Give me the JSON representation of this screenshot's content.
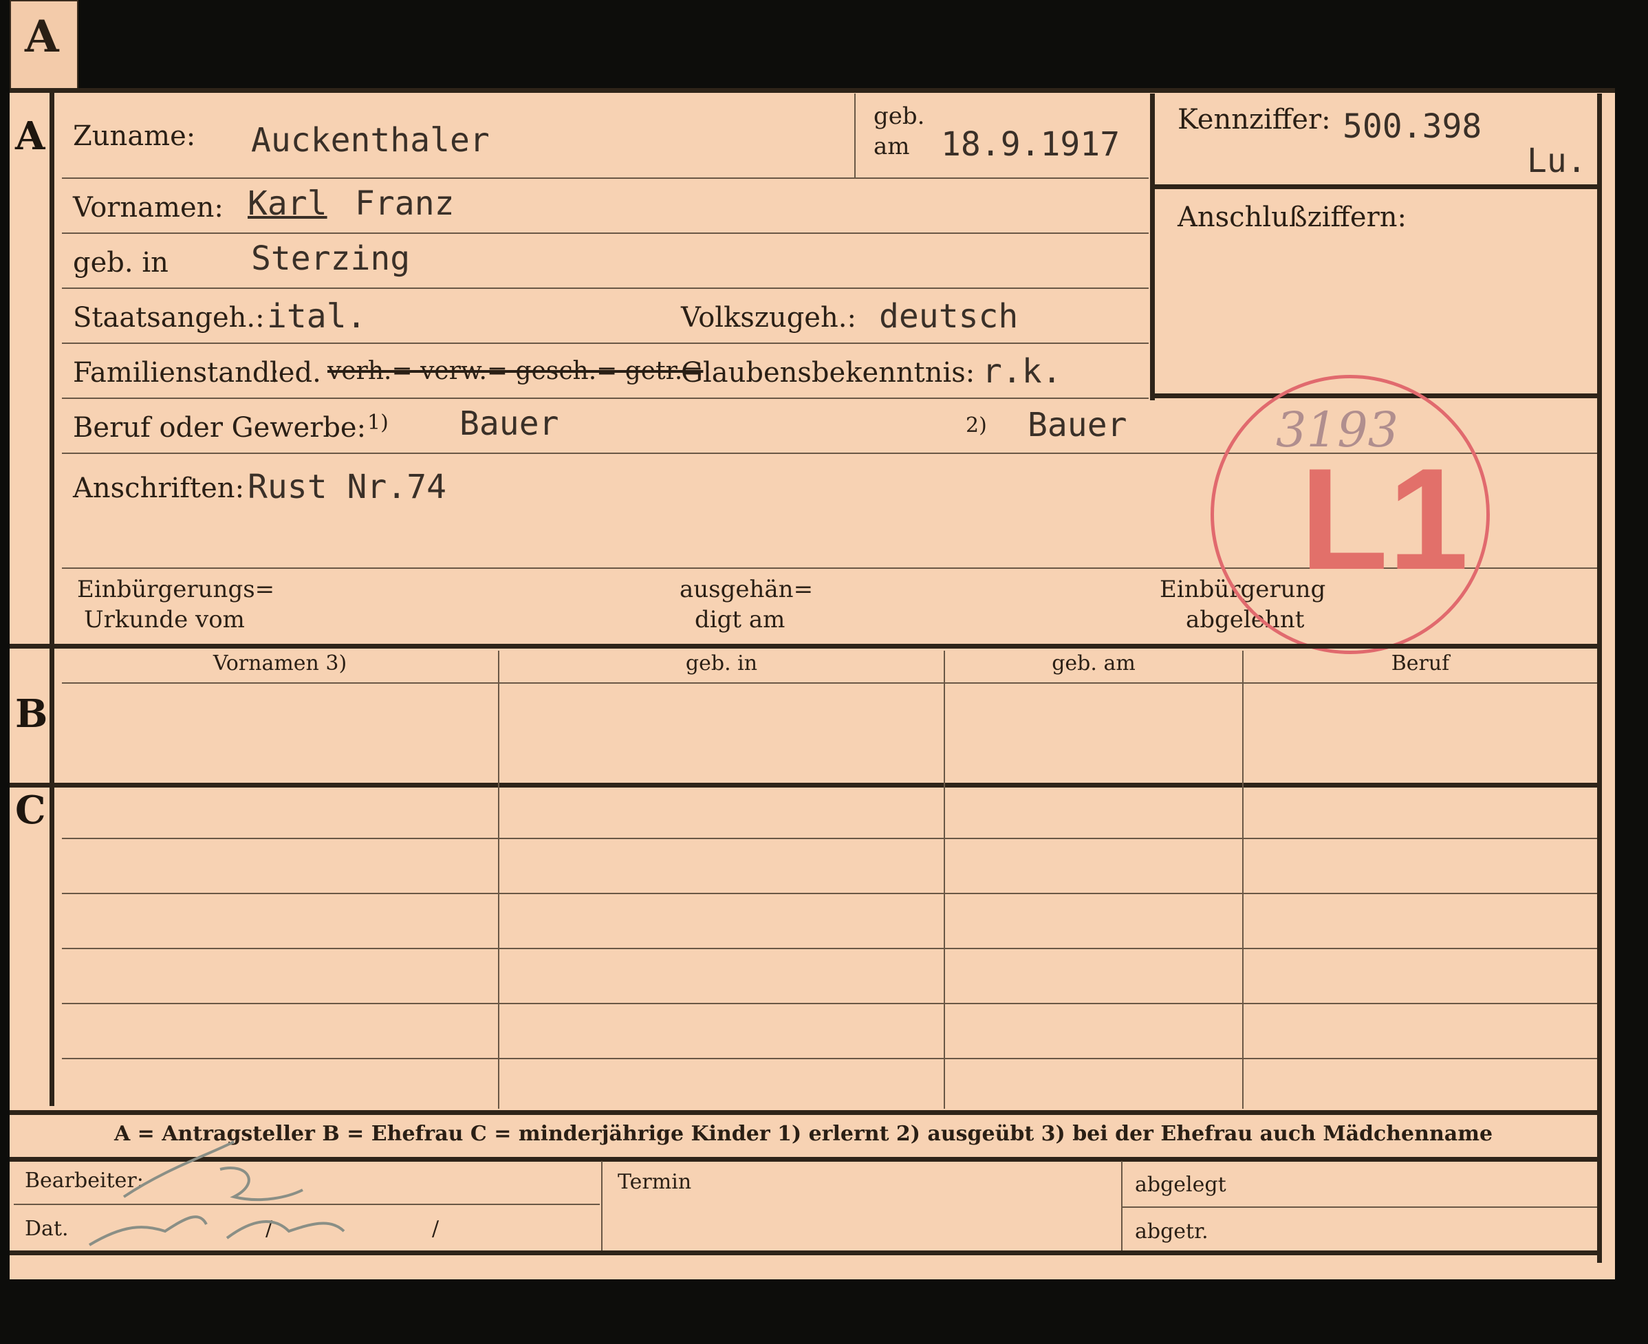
{
  "tab_letter": "A",
  "sections": {
    "a": "A",
    "b": "B",
    "c": "C"
  },
  "fields": {
    "zuname_label": "Zuname:",
    "zuname_value": "Auckenthaler",
    "geb_label": "geb.",
    "am_label": "am",
    "geb_am_value": "18.9.1917",
    "kennziffer_label": "Kennziffer:",
    "kennziffer_value": "500.398",
    "kennziffer_suffix": "Lu.",
    "anschlussziffern_label": "Anschlußziffern:",
    "vornamen_label": "Vornamen:",
    "vornamen_first": "Karl",
    "vornamen_second": "Franz",
    "geb_in_label": "geb. in",
    "geb_in_value": "Sterzing",
    "staatsangeh_label": "Staatsangeh.:",
    "staatsangeh_value": "ital.",
    "volkszugeh_label": "Volkszugeh.:",
    "volkszugeh_value": "deutsch",
    "familienstand_label": "Familienstand:",
    "familienstand_led": "led.",
    "familienstand_struck": "verh.= verw.= gesch.= getr.=",
    "glaubens_label": "Glaubensbekenntnis:",
    "glaubens_value": "r.k.",
    "beruf_label": "Beruf oder Gewerbe:",
    "beruf_mark1": "1)",
    "beruf_value1": "Bauer",
    "beruf_mark2": "2)",
    "beruf_value2": "Bauer",
    "anschriften_label": "Anschriften:",
    "anschriften_value": "Rust Nr.74",
    "einbuergerung_line1": "Einbürgerungs=",
    "einbuergerung_line2": "Urkunde vom",
    "ausgehaendigt_line1": "ausgehän=",
    "ausgehaendigt_line2": "digt am",
    "abgelehnt_line1": "Einbürgerung",
    "abgelehnt_line2": "abgelehnt"
  },
  "stamp": {
    "code": "L1",
    "handwritten": "3193",
    "color": "#e16a6e"
  },
  "table": {
    "headers": [
      "Vornamen 3)",
      "geb. in",
      "geb. am",
      "Beruf"
    ]
  },
  "legend": "A = Antragsteller   B = Ehefrau   C = minderjährige Kinder   1) erlernt   2) ausgeübt   3) bei der Ehefrau auch Mädchenname",
  "footer": {
    "bearbeiter_label": "Bearbeiter:",
    "dat_label": "Dat.",
    "dat_slash1": "/",
    "dat_slash2": "/",
    "termin_label": "Termin",
    "abgelegt_label": "abgelegt",
    "abgetr_label": "abgetr."
  }
}
